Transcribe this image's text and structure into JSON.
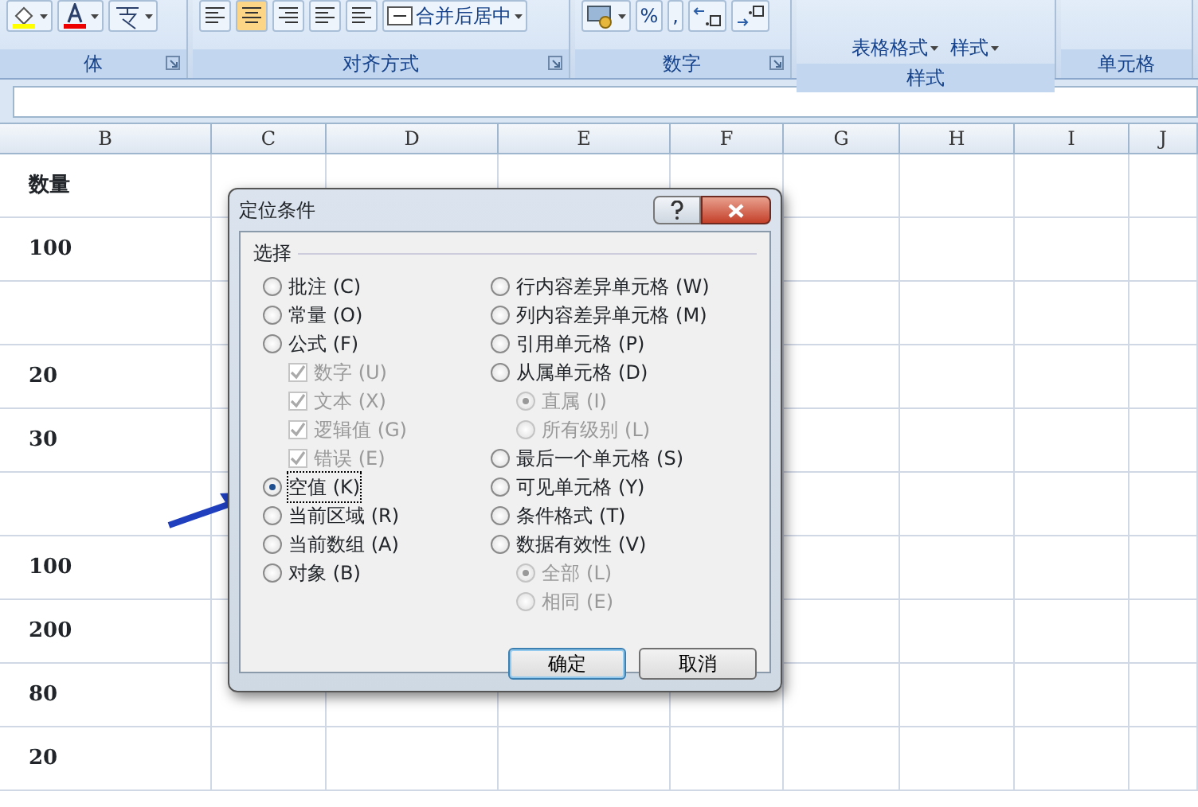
{
  "ribbon": {
    "groups": [
      {
        "label": "体"
      },
      {
        "label": "对齐方式",
        "buttons": [
          {
            "text": "合并后居中"
          }
        ]
      },
      {
        "label": "数字",
        "buttons": [
          {
            "text": "%"
          },
          {
            "text": ","
          }
        ]
      },
      {
        "label": "样式",
        "buttons": [
          {
            "text": "表格格式"
          },
          {
            "text": "样式"
          }
        ]
      },
      {
        "label": "单元格"
      }
    ]
  },
  "sheet": {
    "columns": [
      "B",
      "C",
      "D",
      "E",
      "F",
      "G",
      "H",
      "I",
      "J"
    ],
    "rows": [
      "数量",
      "100",
      "",
      "20",
      "30",
      "",
      "100",
      "200",
      "80",
      "20"
    ]
  },
  "dialog": {
    "title": "定位条件",
    "group_label": "选择",
    "left": [
      {
        "kind": "radio",
        "label": "批注 (C)",
        "selected": false,
        "disabled": false
      },
      {
        "kind": "radio",
        "label": "常量 (O)",
        "selected": false,
        "disabled": false
      },
      {
        "kind": "radio",
        "label": "公式 (F)",
        "selected": false,
        "disabled": false,
        "children": [
          {
            "kind": "checkbox",
            "label": "数字 (U)",
            "checked": true,
            "disabled": true
          },
          {
            "kind": "checkbox",
            "label": "文本 (X)",
            "checked": true,
            "disabled": true
          },
          {
            "kind": "checkbox",
            "label": "逻辑值 (G)",
            "checked": true,
            "disabled": true
          },
          {
            "kind": "checkbox",
            "label": "错误 (E)",
            "checked": true,
            "disabled": true
          }
        ]
      },
      {
        "kind": "radio",
        "label": "空值 (K)",
        "selected": true,
        "disabled": false
      },
      {
        "kind": "radio",
        "label": "当前区域 (R)",
        "selected": false,
        "disabled": false
      },
      {
        "kind": "radio",
        "label": "当前数组 (A)",
        "selected": false,
        "disabled": false
      },
      {
        "kind": "radio",
        "label": "对象 (B)",
        "selected": false,
        "disabled": false
      }
    ],
    "right": [
      {
        "kind": "radio",
        "label": "行内容差异单元格 (W)",
        "selected": false,
        "disabled": false
      },
      {
        "kind": "radio",
        "label": "列内容差异单元格 (M)",
        "selected": false,
        "disabled": false
      },
      {
        "kind": "radio",
        "label": "引用单元格 (P)",
        "selected": false,
        "disabled": false
      },
      {
        "kind": "radio",
        "label": "从属单元格 (D)",
        "selected": false,
        "disabled": false,
        "children": [
          {
            "kind": "radio",
            "label": "直属 (I)",
            "selected": true,
            "disabled": true
          },
          {
            "kind": "radio",
            "label": "所有级别 (L)",
            "selected": false,
            "disabled": true
          }
        ]
      },
      {
        "kind": "radio",
        "label": "最后一个单元格 (S)",
        "selected": false,
        "disabled": false
      },
      {
        "kind": "radio",
        "label": "可见单元格 (Y)",
        "selected": false,
        "disabled": false
      },
      {
        "kind": "radio",
        "label": "条件格式 (T)",
        "selected": false,
        "disabled": false
      },
      {
        "kind": "radio",
        "label": "数据有效性 (V)",
        "selected": false,
        "disabled": false,
        "children": [
          {
            "kind": "radio",
            "label": "全部 (L)",
            "selected": true,
            "disabled": true
          },
          {
            "kind": "radio",
            "label": "相同 (E)",
            "selected": false,
            "disabled": true
          }
        ]
      }
    ],
    "buttons": [
      {
        "label": "确定",
        "default": true
      },
      {
        "label": "取消",
        "default": false
      }
    ]
  }
}
